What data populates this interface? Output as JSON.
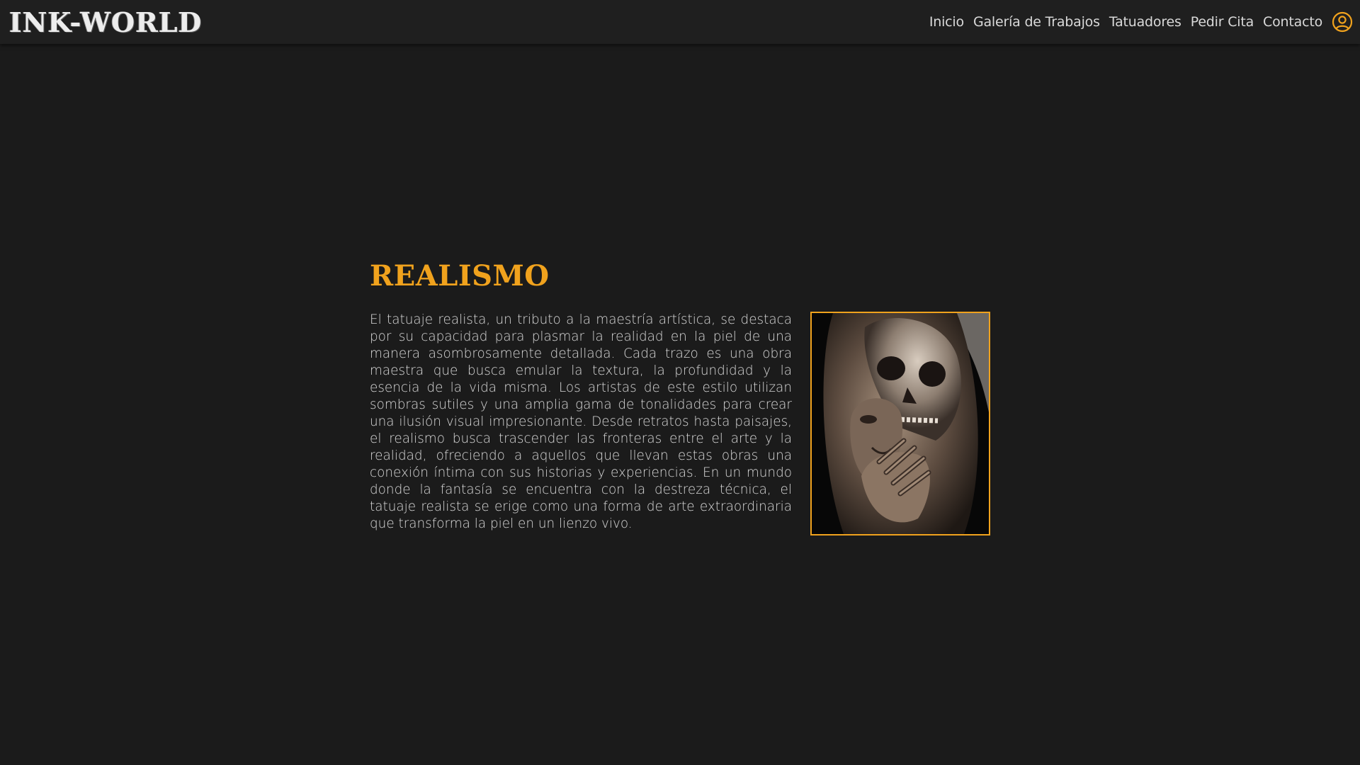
{
  "header": {
    "logo": "INK-WORLD",
    "nav": [
      {
        "label": "Inicio"
      },
      {
        "label": "Galería de Trabajos"
      },
      {
        "label": "Tatuadores"
      },
      {
        "label": "Pedir Cita"
      },
      {
        "label": "Contacto"
      }
    ],
    "user_icon": "user-circle-icon"
  },
  "main": {
    "title": "REALISMO",
    "description": "El tatuaje realista, un tributo a la maestría artística, se destaca por su capacidad para plasmar la realidad en la piel de una manera asombrosamente detallada. Cada trazo es una obra maestra que busca emular la textura, la profundidad y la esencia de la vida misma. Los artistas de este estilo utilizan sombras sutiles y una amplia gama de tonalidades para crear una ilusión visual impresionante. Desde retratos hasta paisajes, el realismo busca trascender las fronteras entre el arte y la realidad, ofreciendo a aquellos que llevan estas obras una conexión íntima con sus historias y experiencias. En un mundo donde la fantasía se encuentra con la destreza técnica, el tatuaje realista se erige como una forma de arte extraordinaria que transforma la piel en un lienzo vivo."
  },
  "colors": {
    "accent": "#f0a21d",
    "background": "#1b1b1b",
    "header_background": "#1f1f1f",
    "text": "#d9d9d9"
  }
}
